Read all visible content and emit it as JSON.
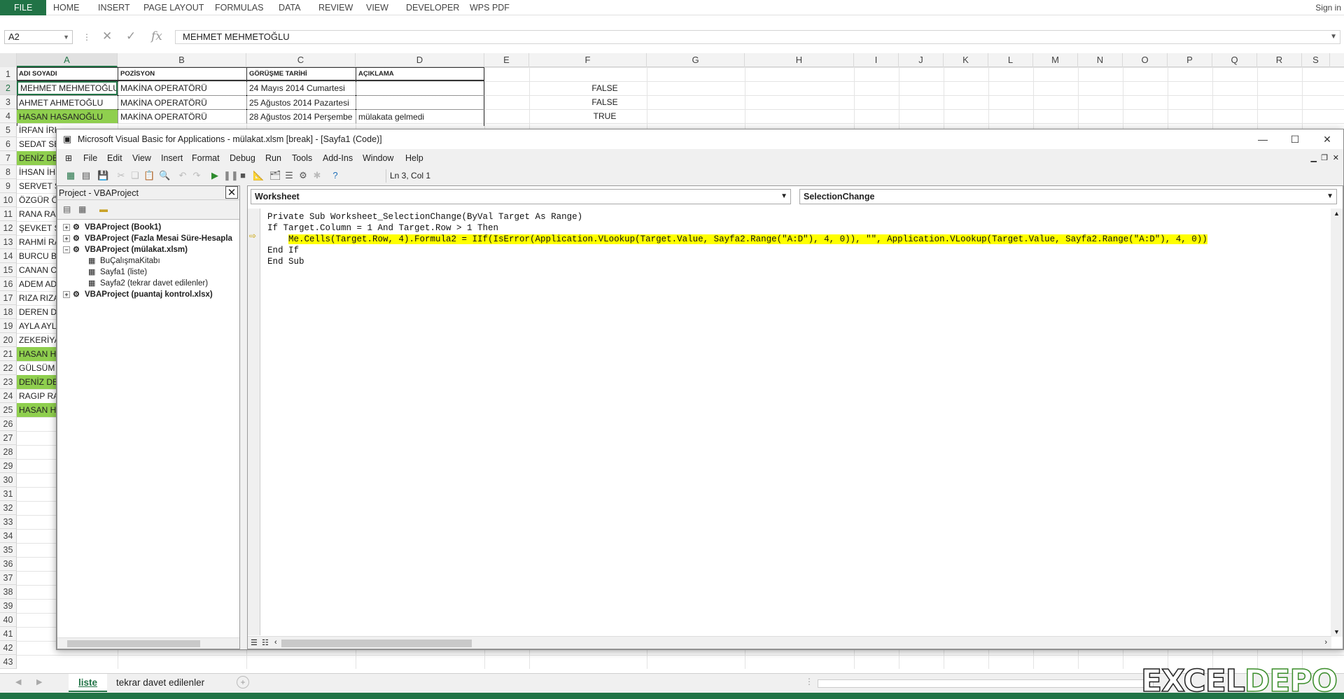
{
  "ribbon": {
    "file": "FILE",
    "tabs": [
      "HOME",
      "INSERT",
      "PAGE LAYOUT",
      "FORMULAS",
      "DATA",
      "REVIEW",
      "VIEW",
      "DEVELOPER",
      "WPS PDF"
    ],
    "sign_in": "Sign in"
  },
  "formula_bar": {
    "name_box": "A2",
    "fx": "fx",
    "value": "MEHMET MEHMETOĞLU"
  },
  "columns": [
    "A",
    "B",
    "C",
    "D",
    "E",
    "F",
    "G",
    "H",
    "I",
    "J",
    "K",
    "L",
    "M",
    "N",
    "O",
    "P",
    "Q",
    "R",
    "S"
  ],
  "rows": [
    "1",
    "2",
    "3",
    "4",
    "5",
    "6",
    "7",
    "8",
    "9",
    "10",
    "11",
    "12",
    "13",
    "14",
    "15",
    "16",
    "17",
    "18",
    "19",
    "20",
    "21",
    "22",
    "23",
    "24",
    "25",
    "26",
    "27",
    "28",
    "29",
    "30",
    "31",
    "32",
    "33",
    "34",
    "35",
    "36",
    "37",
    "38",
    "39",
    "40",
    "41",
    "42",
    "43"
  ],
  "sheet": {
    "headers": [
      "ADI SOYADI",
      "POZİSYON",
      "GÖRÜŞME TARİHİ",
      "AÇIKLAMA"
    ],
    "top_rows": [
      {
        "a": "MEHMET MEHMETOĞLU",
        "b": "MAKİNA OPERATÖRÜ",
        "c": "24 Mayıs 2014 Cumartesi",
        "d": "",
        "f": "FALSE",
        "green": false
      },
      {
        "a": "AHMET AHMETOĞLU",
        "b": "MAKİNA OPERATÖRÜ",
        "c": "25 Ağustos 2014 Pazartesi",
        "d": "",
        "f": "FALSE",
        "green": false
      },
      {
        "a": "HASAN HASANOĞLU",
        "b": "MAKİNA OPERATÖRÜ",
        "c": "28 Ağustos 2014 Perşembe",
        "d": "mülakata gelmedi",
        "f": "TRUE",
        "green": true
      }
    ],
    "partial_names": [
      {
        "t": "İRFAN İRF",
        "g": false
      },
      {
        "t": "SEDAT SED",
        "g": false
      },
      {
        "t": "DENİZ DEN",
        "g": true
      },
      {
        "t": "İHSAN İHS",
        "g": false
      },
      {
        "t": "SERVET SE",
        "g": false
      },
      {
        "t": "ÖZGÜR ÖZ",
        "g": false
      },
      {
        "t": "RANA RAN",
        "g": false
      },
      {
        "t": "ŞEVKET ŞE",
        "g": false
      },
      {
        "t": "RAHMİ RA",
        "g": false
      },
      {
        "t": "BURCU BU",
        "g": false
      },
      {
        "t": "CANAN CA",
        "g": false
      },
      {
        "t": "ADEM ADE",
        "g": false
      },
      {
        "t": "RIZA RIZA",
        "g": false
      },
      {
        "t": "DEREN DE",
        "g": false
      },
      {
        "t": "AYLA AYLA",
        "g": false
      },
      {
        "t": "ZEKERİYA",
        "g": false
      },
      {
        "t": "HASAN HA",
        "g": true
      },
      {
        "t": "GÜLSÜM G",
        "g": false
      },
      {
        "t": "DENİZ DEN",
        "g": true
      },
      {
        "t": "RAGIP RA",
        "g": false
      },
      {
        "t": "HASAN HA",
        "g": true
      }
    ]
  },
  "sheet_tabs": {
    "active": "liste",
    "other": "tekrar davet edilenler"
  },
  "vbe": {
    "title": "Microsoft Visual Basic for Applications - mülakat.xlsm [break] - [Sayfa1 (Code)]",
    "menu": [
      "File",
      "Edit",
      "View",
      "Insert",
      "Format",
      "Debug",
      "Run",
      "Tools",
      "Add-Ins",
      "Window",
      "Help"
    ],
    "position": "Ln 3, Col 1",
    "project_title": "Project - VBAProject",
    "tree": [
      "VBAProject (Book1)",
      "VBAProject (Fazla Mesai Süre-Hesapla",
      "VBAProject (mülakat.xlsm)",
      "BuÇalışmaKitabı",
      "Sayfa1 (liste)",
      "Sayfa2 (tekrar davet edilenler)",
      "VBAProject (puantaj kontrol.xlsx)"
    ],
    "object_combo": "Worksheet",
    "proc_combo": "SelectionChange",
    "code": [
      "Private Sub Worksheet_SelectionChange(ByVal Target As Range)",
      "If Target.Column = 1 And Target.Row > 1 Then",
      "Me.Cells(Target.Row, 4).Formula2 = IIf(IsError(Application.VLookup(Target.Value, Sayfa2.Range(\"A:D\"), 4, 0)), \"\", Application.VLookup(Target.Value, Sayfa2.Range(\"A:D\"), 4, 0))",
      "End If",
      "End Sub"
    ]
  },
  "watermark": {
    "a": "EXCEL",
    "b": "DEPO"
  },
  "colors": {
    "excel_green": "#217346",
    "row_highlight": "#8fcf4e",
    "debug_line": "#ffff00"
  }
}
